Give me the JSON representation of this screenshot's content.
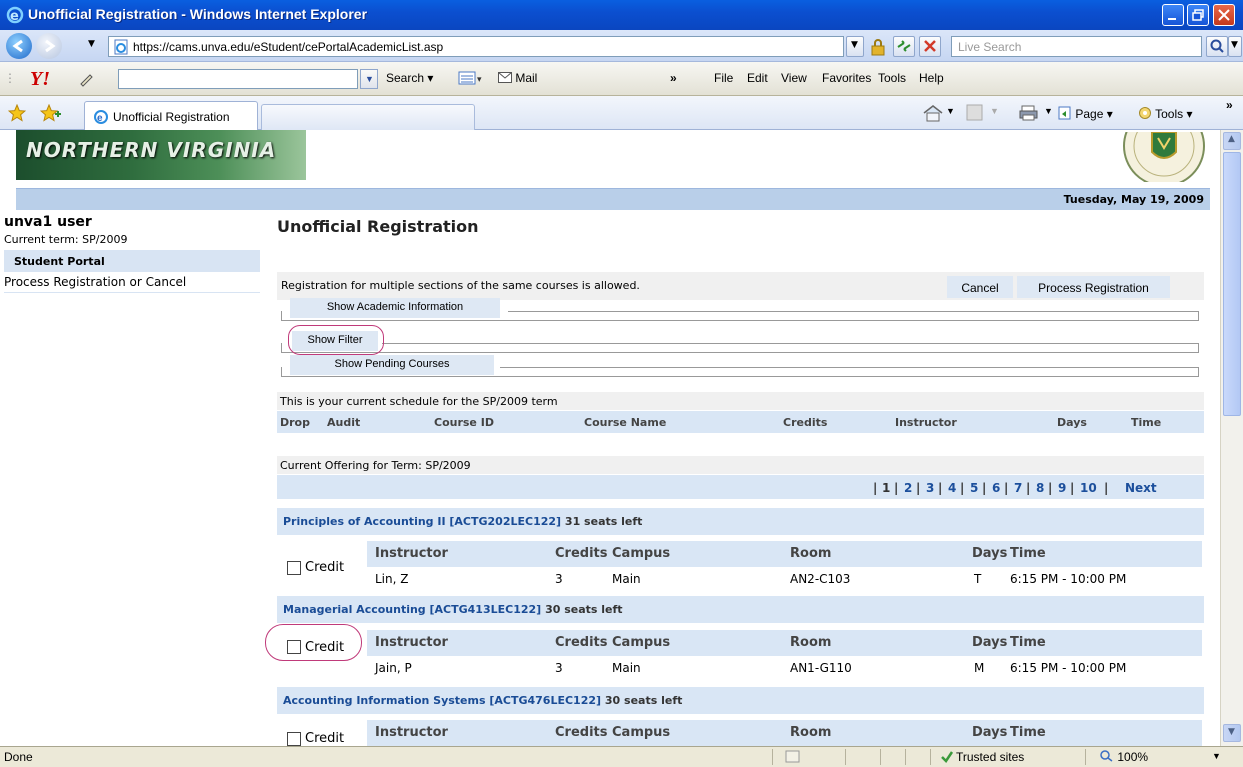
{
  "window": {
    "title": "Unofficial Registration - Windows Internet Explorer"
  },
  "address": {
    "url": "https://cams.unva.edu/eStudent/cePortalAcademicList.asp",
    "live_search_placeholder": "Live Search"
  },
  "yahoo_toolbar": {
    "logo": "Y!",
    "search_label": "Search",
    "mail_label": "Mail",
    "more": "»",
    "menus": [
      "File",
      "Edit",
      "View",
      "Favorites",
      "Tools",
      "Help"
    ]
  },
  "tabs": {
    "active_tab": "Unofficial Registration",
    "command_bar": {
      "page": "Page",
      "tools": "Tools",
      "more": "»"
    }
  },
  "page": {
    "banner_text": "NORTHERN VIRGINIA",
    "date": "Tuesday, May 19, 2009",
    "sidebar": {
      "user": "unva1 user",
      "term": "Current term: SP/2009",
      "portal": "Student Portal",
      "item": "Process Registration or Cancel"
    },
    "title": "Unofficial Registration",
    "reg_message": "Registration for multiple sections of the same courses is allowed.",
    "cancel_label": "Cancel",
    "process_label": "Process Registration",
    "show_academic": "Show Academic Information",
    "show_filter": "Show Filter",
    "show_pending": "Show Pending Courses",
    "schedule_caption": "This is your current schedule for the SP/2009 term",
    "schedule_columns": {
      "drop": "Drop",
      "audit": "Audit",
      "course_id": "Course ID",
      "course_name": "Course Name",
      "credits": "Credits",
      "instructor": "Instructor",
      "days": "Days",
      "time": "Time"
    },
    "offering_caption": "Current Offering for Term: SP/2009",
    "pager": {
      "pages": [
        "1",
        "2",
        "3",
        "4",
        "5",
        "6",
        "7",
        "8",
        "9",
        "10"
      ],
      "next": "Next",
      "separator": "|"
    },
    "course_columns": {
      "instructor": "Instructor",
      "credits": "Credits",
      "campus": "Campus",
      "room": "Room",
      "days": "Days",
      "time": "Time"
    },
    "credit_label": "Credit",
    "courses": [
      {
        "heading": "Principles of Accounting II [ACTG202LEC122]",
        "seats": "31 seats left",
        "instructor": "Lin, Z",
        "credits": "3",
        "campus": "Main",
        "room": "AN2-C103",
        "days": "T",
        "time": "6:15 PM - 10:00 PM"
      },
      {
        "heading": "Managerial Accounting [ACTG413LEC122]",
        "seats": "30 seats left",
        "instructor": "Jain, P",
        "credits": "3",
        "campus": "Main",
        "room": "AN1-G110",
        "days": "M",
        "time": "6:15 PM - 10:00 PM"
      },
      {
        "heading": "Accounting Information Systems [ACTG476LEC122]",
        "seats": "30 seats left"
      }
    ]
  },
  "status": {
    "text": "Done",
    "zone": "Trusted sites",
    "zoom": "100%"
  },
  "colors": {
    "titlebar": "#0b4fd0",
    "header_band": "#d9e6f5",
    "link_blue": "#1a4c96",
    "annotation_oval": "#c03a7a"
  }
}
